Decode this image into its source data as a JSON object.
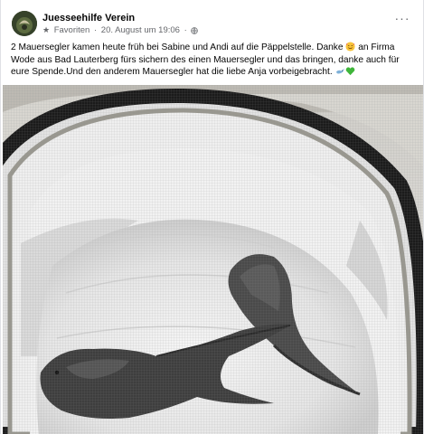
{
  "post": {
    "author": "Juesseehilfe Verein",
    "audience_label": "Favoriten",
    "timestamp": "20. August um 19:06",
    "separator": "·",
    "more_label": "···",
    "text_before_emoji_1": "2 Mauersegler kamen heute früh bei Sabine und Andi auf die Päppelstelle. Danke ",
    "emoji_1": "smiling-face-with-hearts",
    "text_after_emoji_1": " an Firma Wode aus Bad Lauterberg fürs sichern des einen Mauersegler  und das bringen, danke auch  für eure Spende.Und den anderem Mauersegler hat die liebe Anja vorbeigebracht. ",
    "emoji_2": "bird",
    "emoji_3": "green-heart",
    "photo_subject": "two swifts lying in a mesh pop-up enclosure"
  },
  "colors": {
    "author_text": "#050505",
    "meta_text": "#65676b",
    "emoji_yellow": "#f7c33a",
    "heart_green": "#3fb53a",
    "bird_blue": "#7fb1d8"
  }
}
